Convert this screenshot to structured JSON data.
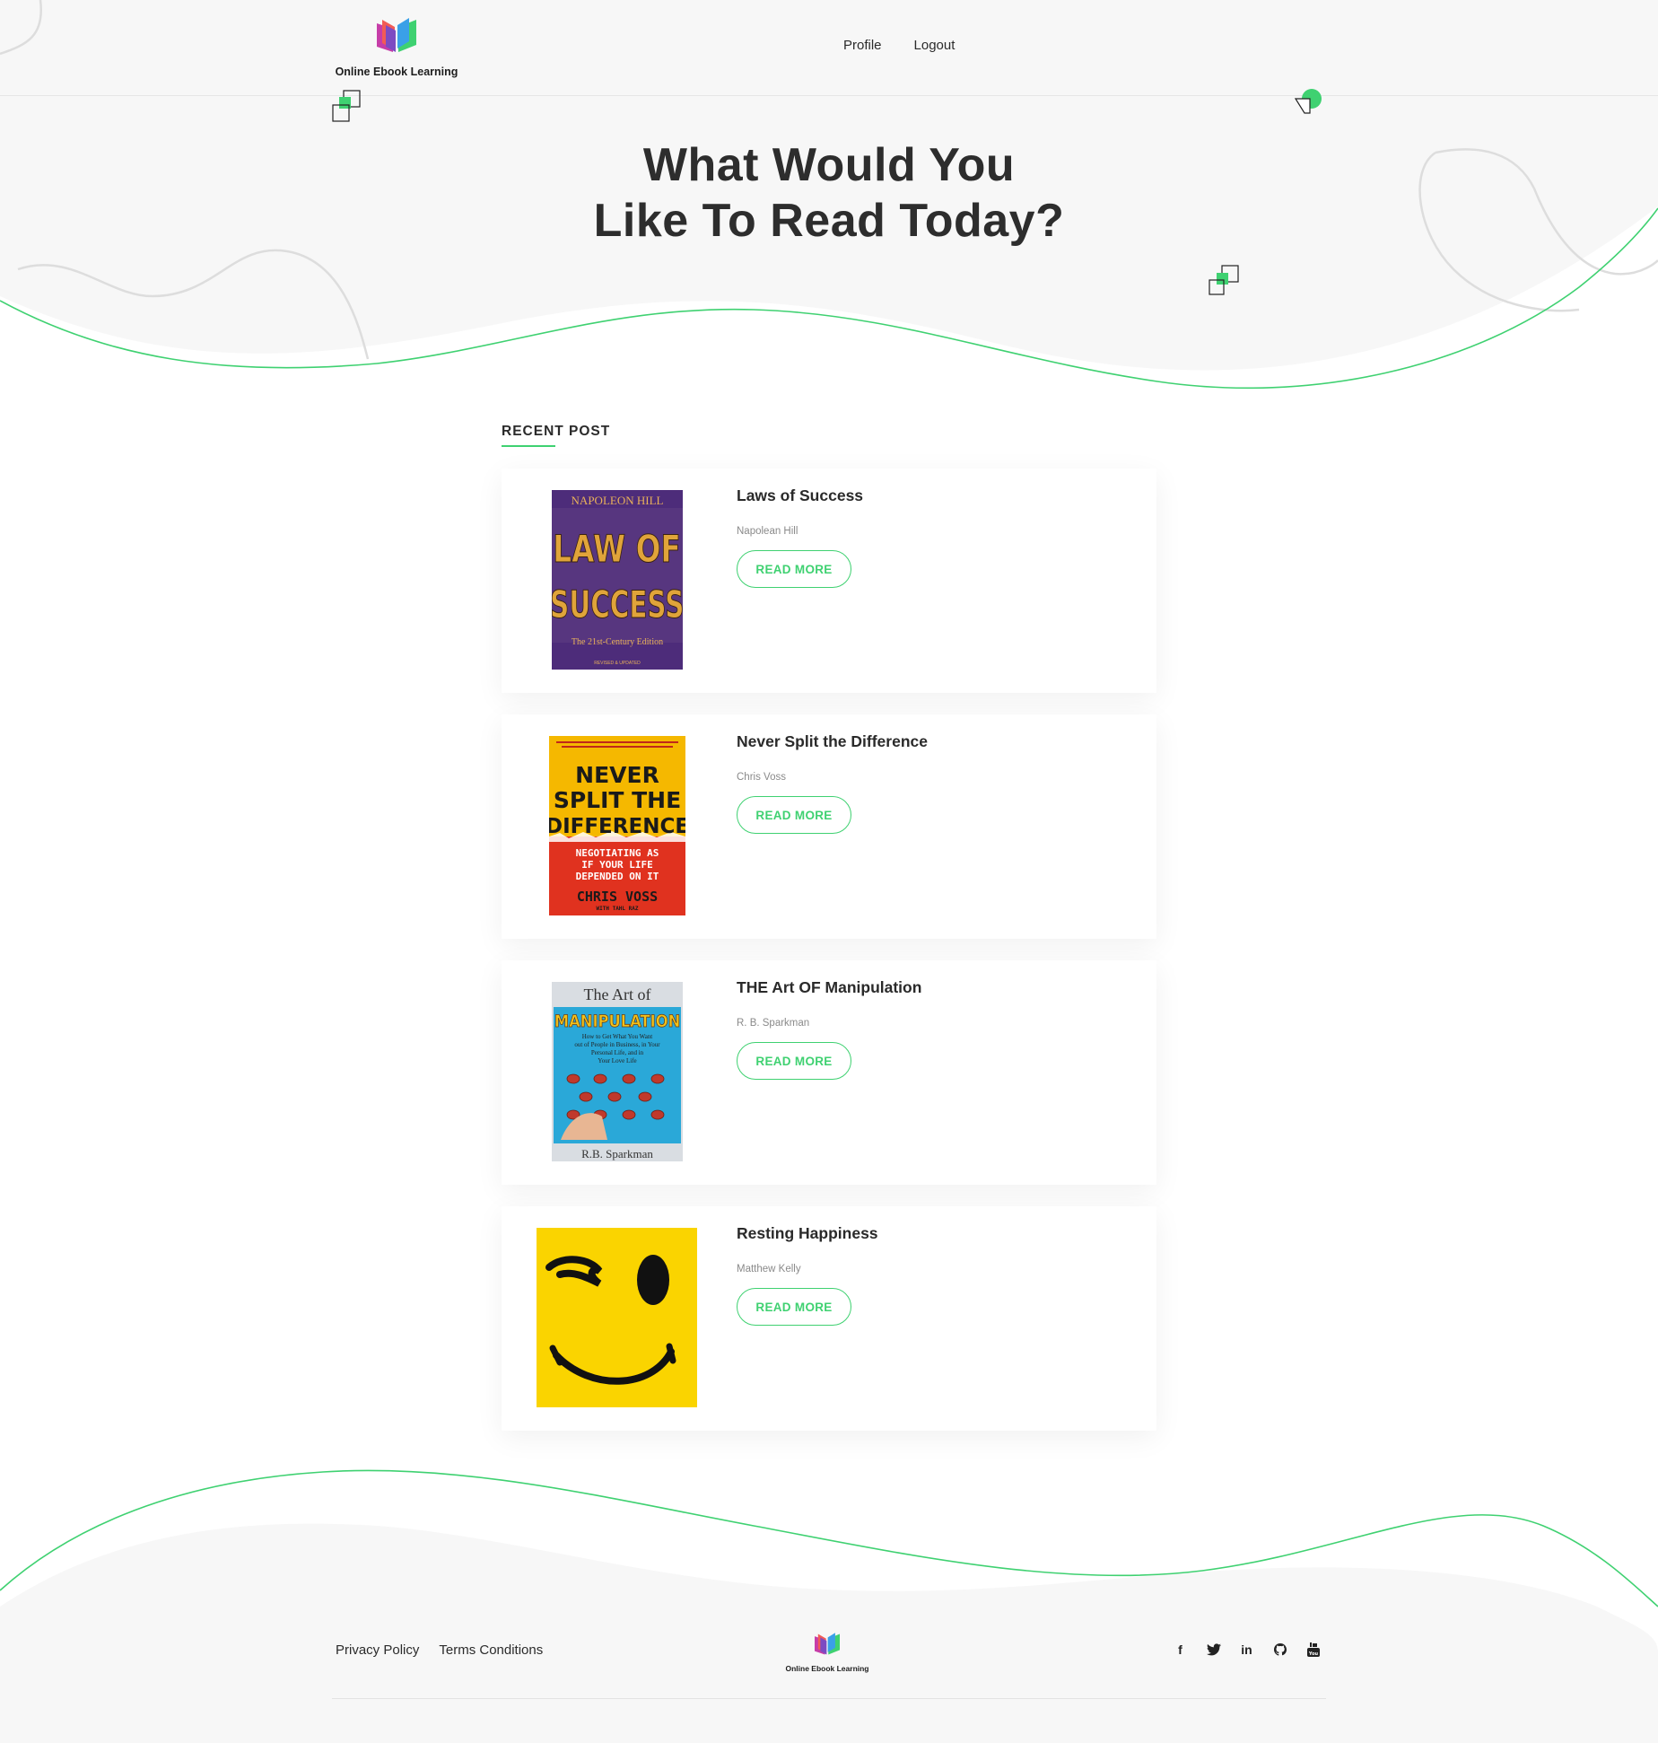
{
  "header": {
    "logo_text": "Online Ebook Learning",
    "nav": {
      "profile": "Profile",
      "logout": "Logout"
    }
  },
  "hero": {
    "title_line1": "What Would You",
    "title_line2": "Like To Read Today?"
  },
  "recent": {
    "label": "RECENT POST",
    "posts": [
      {
        "title": "Laws of Success",
        "author": "Napolean Hill",
        "button": "READ MORE",
        "cover": {
          "top": "NAPOLEON HILL",
          "main1": "LAW OF",
          "main2": "SUCCESS",
          "edition": "The 21st-Century Edition",
          "note": "REVISED & UPDATED",
          "bg": "#4d2c7a",
          "accent": "#e0a43a"
        }
      },
      {
        "title": "Never Split the Difference",
        "author": "Chris Voss",
        "button": "READ MORE",
        "cover": {
          "main1": "NEVER",
          "main2": "SPLIT THE",
          "main3": "DIFFERENCE",
          "sub1": "NEGOTIATING AS",
          "sub2": "IF YOUR LIFE",
          "sub3": "DEPENDED ON IT",
          "author": "CHRIS VOSS",
          "coauthor": "WITH TAHL RAZ",
          "top_color": "#f5b800",
          "bottom_color": "#e0321f"
        }
      },
      {
        "title": "THE Art OF Manipulation",
        "author": "R. B. Sparkman",
        "button": "READ MORE",
        "cover": {
          "top": "The Art of",
          "main": "MANIPULATION",
          "sub1": "How to Get What You Want",
          "sub2": "out of People in Business, in Your",
          "sub3": "Personal Life, and in",
          "sub4": "Your Love Life",
          "author": "R.B. Sparkman",
          "bg": "#2aa8d8",
          "frame": "#d9dde2"
        }
      },
      {
        "title": "Resting Happiness",
        "author": "Matthew Kelly",
        "button": "READ MORE",
        "cover": {
          "bg": "#fad400"
        }
      }
    ]
  },
  "footer": {
    "privacy": "Privacy Policy",
    "terms": "Terms Conditions",
    "logo_text": "Online Ebook Learning",
    "social": [
      "facebook-icon",
      "twitter-icon",
      "linkedin-icon",
      "github-icon",
      "youtube-icon"
    ],
    "social_glyphs": [
      "f",
      "🐦",
      "in",
      "◉",
      "▶"
    ]
  },
  "colors": {
    "accent": "#3fd171",
    "hero_bg": "#f7f7f7",
    "text": "#2b2b2b"
  }
}
